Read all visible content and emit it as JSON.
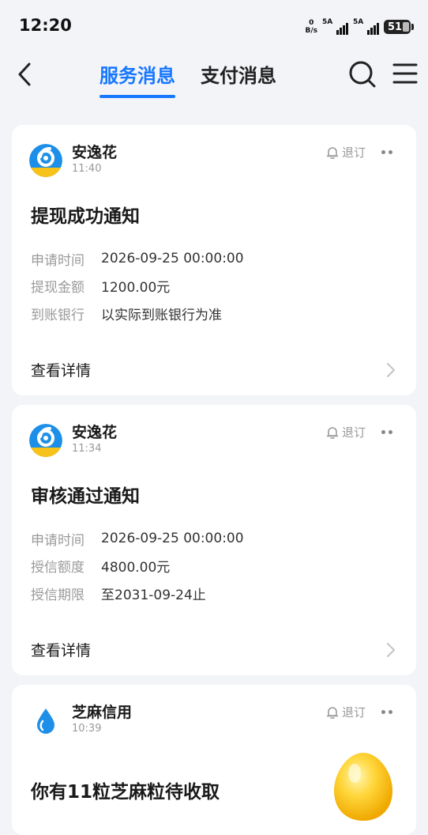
{
  "status_bar": {
    "time": "12:20",
    "net_speed_value": "0",
    "net_speed_unit": "B/s",
    "sim1_label": "5A",
    "sim2_label": "5A",
    "battery": "51"
  },
  "nav": {
    "tabs": [
      {
        "label": "服务消息",
        "active": true
      },
      {
        "label": "支付消息",
        "active": false
      }
    ],
    "accent_color": "#1677ff"
  },
  "messages": [
    {
      "sender": "安逸花",
      "time": "11:40",
      "unsubscribe_label": "退订",
      "title": "提现成功通知",
      "rows": [
        {
          "key": "申请时间",
          "value": "2026-09-25 00:00:00"
        },
        {
          "key": "提现金额",
          "value": "1200.00元"
        },
        {
          "key": "到账银行",
          "value": "以实际到账银行为准"
        }
      ],
      "detail_label": "查看详情"
    },
    {
      "sender": "安逸花",
      "time": "11:34",
      "unsubscribe_label": "退订",
      "title": "审核通过通知",
      "rows": [
        {
          "key": "申请时间",
          "value": "2026-09-25 00:00:00"
        },
        {
          "key": "授信额度",
          "value": "4800.00元"
        },
        {
          "key": "授信期限",
          "value": "至2031-09-24止"
        }
      ],
      "detail_label": "查看详情"
    },
    {
      "sender": "芝麻信用",
      "time": "10:39",
      "unsubscribe_label": "退订",
      "title": "你有11粒芝麻粒待收取"
    }
  ]
}
